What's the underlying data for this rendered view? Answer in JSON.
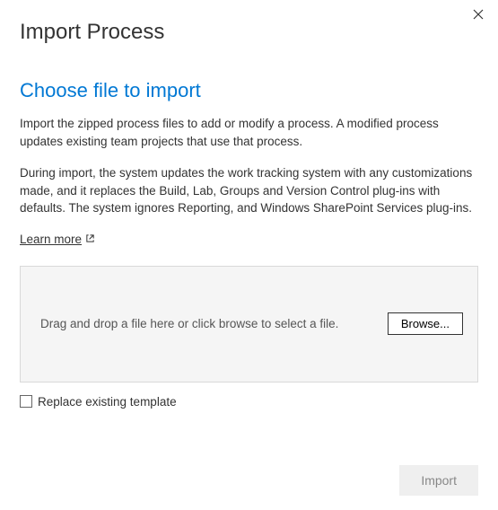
{
  "dialog": {
    "title": "Import Process"
  },
  "section": {
    "heading": "Choose file to import",
    "para1": "Import the zipped process files to add or modify a process. A modified process updates existing team projects that use that process.",
    "para2": "During import, the system updates the work tracking system with any customizations made, and it replaces the Build, Lab, Groups and Version Control plug-ins with defaults. The system ignores Reporting, and Windows SharePoint Services plug-ins."
  },
  "learnMore": {
    "label": "Learn more"
  },
  "dropzone": {
    "text": "Drag and drop a file here or click browse to select a file.",
    "browseLabel": "Browse..."
  },
  "checkbox": {
    "label": "Replace existing template",
    "checked": false
  },
  "footer": {
    "importLabel": "Import"
  }
}
